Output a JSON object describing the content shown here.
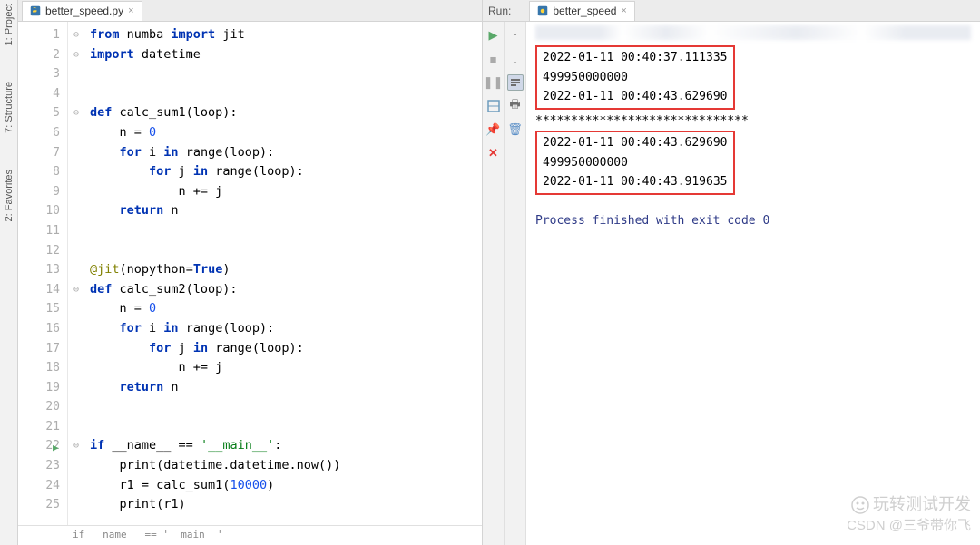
{
  "leftTools": {
    "project": "1: Project",
    "structure": "7: Structure",
    "favorites": "2: Favorites"
  },
  "editor": {
    "tab": {
      "filename": "better_speed.py"
    },
    "breadcrumb": "if __name__ == '__main__'",
    "lines": [
      "1",
      "2",
      "3",
      "4",
      "5",
      "6",
      "7",
      "8",
      "9",
      "10",
      "11",
      "12",
      "13",
      "14",
      "15",
      "16",
      "17",
      "18",
      "19",
      "20",
      "21",
      "22",
      "23",
      "24",
      "25"
    ]
  },
  "code": {
    "l1a": "from",
    "l1b": " numba ",
    "l1c": "import",
    "l1d": " jit",
    "l2a": "import",
    "l2b": " datetime",
    "l5a": "def",
    "l5b": " calc_sum1(loop):",
    "l6": "    n = ",
    "l6n": "0",
    "l7a": "    ",
    "l7b": "for",
    "l7c": " i ",
    "l7d": "in",
    "l7e": " range(loop):",
    "l8a": "        ",
    "l8b": "for",
    "l8c": " j ",
    "l8d": "in",
    "l8e": " range(loop):",
    "l9": "            n += j",
    "l10a": "    ",
    "l10b": "return",
    "l10c": " n",
    "l13a": "@jit",
    "l13b": "(",
    "l13c": "nopython",
    "l13d": "=",
    "l13e": "True",
    "l13f": ")",
    "l14a": "def",
    "l14b": " calc_sum2(loop):",
    "l15": "    n = ",
    "l15n": "0",
    "l16a": "    ",
    "l16b": "for",
    "l16c": " i ",
    "l16d": "in",
    "l16e": " range(loop):",
    "l17a": "        ",
    "l17b": "for",
    "l17c": " j ",
    "l17d": "in",
    "l17e": " range(loop):",
    "l18": "            n += j",
    "l19a": "    ",
    "l19b": "return",
    "l19c": " n",
    "l22a": "if",
    "l22b": " __name__ == ",
    "l22c": "'__main__'",
    "l22d": ":",
    "l23a": "    print(datetime.datetime.now())",
    "l24a": "    r1 = calc_sum1(",
    "l24b": "10000",
    "l24c": ")",
    "l25": "    print(r1)"
  },
  "run": {
    "label": "Run:",
    "tab": "better_speed",
    "output": {
      "box1": {
        "l1": "2022-01-11 00:40:37.111335",
        "l2": "499950000000",
        "l3": "2022-01-11 00:40:43.629690"
      },
      "sep": "******************************",
      "box2": {
        "l1": "2022-01-11 00:40:43.629690",
        "l2": "499950000000",
        "l3": "2022-01-11 00:40:43.919635"
      },
      "exit": "Process finished with exit code 0"
    }
  },
  "watermark": {
    "line1": "玩转测试开发",
    "line2": "CSDN @三爷带你飞"
  }
}
